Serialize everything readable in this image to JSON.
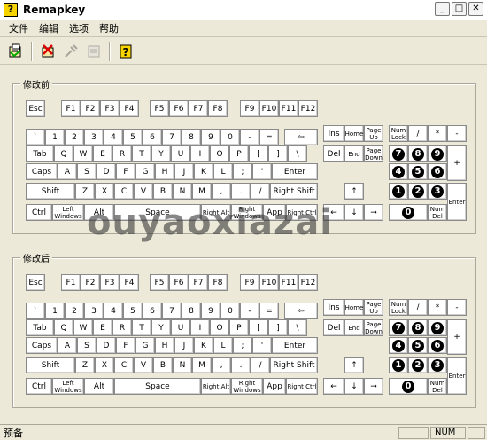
{
  "window": {
    "title": "Remapkey",
    "app_icon_glyph": "?",
    "btn_minimize": "_",
    "btn_maximize": "□",
    "btn_close": "✕"
  },
  "menu": [
    "文件",
    "编辑",
    "选项",
    "帮助"
  ],
  "toolbar": {
    "items": [
      "open-icon",
      "delete-icon",
      "tools-icon",
      "window-icon",
      "help-icon"
    ]
  },
  "groups": {
    "before": "修改前",
    "after": "修改后"
  },
  "keys": {
    "esc": "Esc",
    "f": [
      "F1",
      "F2",
      "F3",
      "F4",
      "F5",
      "F6",
      "F7",
      "F8",
      "F9",
      "F10",
      "F11",
      "F12"
    ],
    "row1": [
      "`",
      "1",
      "2",
      "3",
      "4",
      "5",
      "6",
      "7",
      "8",
      "9",
      "0",
      "-",
      "="
    ],
    "backspace": "⇦",
    "tab": "Tab",
    "row2": [
      "Q",
      "W",
      "E",
      "R",
      "T",
      "Y",
      "U",
      "I",
      "O",
      "P",
      "[",
      "]",
      "\\"
    ],
    "caps": "Caps",
    "row3": [
      "A",
      "S",
      "D",
      "F",
      "G",
      "H",
      "J",
      "K",
      "L",
      ";",
      "'"
    ],
    "enter": "Enter",
    "shift_l": "Shift",
    "row4": [
      "Z",
      "X",
      "C",
      "V",
      "B",
      "N",
      "M",
      ",",
      ".",
      "/"
    ],
    "shift_r": "Right Shift",
    "ctrl_l": "Ctrl",
    "win_l": "Left Windows",
    "alt_l": "Alt",
    "space": "Space",
    "alt_r": "Right Alt",
    "win_r": "Right Windows",
    "app": "App",
    "ctrl_r": "Right Ctrl",
    "nav": [
      "Ins",
      "Home",
      "Page Up",
      "Del",
      "End",
      "Page Down"
    ],
    "arrows": [
      "↑",
      "←",
      "↓",
      "→"
    ],
    "numlock": "Num Lock",
    "num_div": "/",
    "num_mul": "*",
    "num_minus": "-",
    "num_plus": "+",
    "num_enter": "Enter",
    "num_digits": [
      "7",
      "8",
      "9",
      "4",
      "5",
      "6",
      "1",
      "2",
      "3",
      "0"
    ],
    "num_del": "Num Del"
  },
  "watermark": "ouyaoxiazai",
  "status": {
    "text": "预备",
    "num": "NUM"
  }
}
